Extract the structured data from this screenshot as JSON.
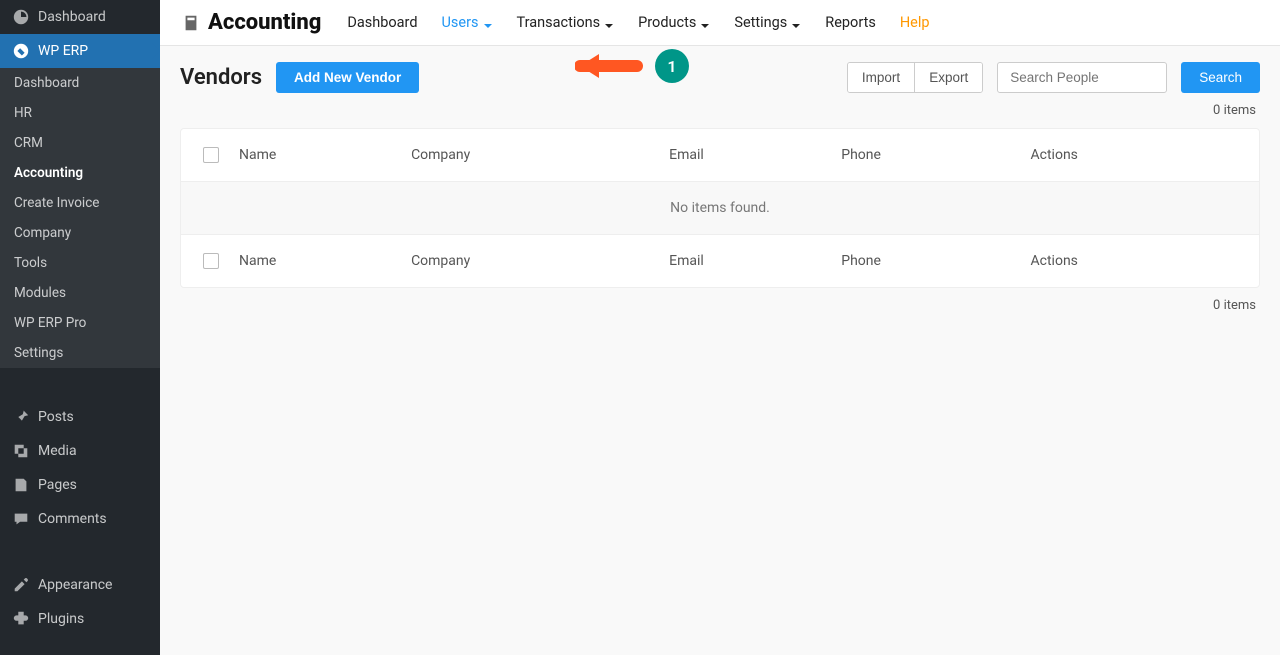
{
  "sidebar": {
    "top": [
      {
        "label": "Dashboard",
        "icon": "dashboard"
      },
      {
        "label": "WP ERP",
        "icon": "erp",
        "active": true
      }
    ],
    "sub": [
      {
        "label": "Dashboard"
      },
      {
        "label": "HR"
      },
      {
        "label": "CRM"
      },
      {
        "label": "Accounting",
        "current": true
      },
      {
        "label": "Create Invoice"
      },
      {
        "label": "Company"
      },
      {
        "label": "Tools"
      },
      {
        "label": "Modules"
      },
      {
        "label": "WP ERP Pro"
      },
      {
        "label": "Settings"
      }
    ],
    "bottom": [
      {
        "label": "Posts",
        "icon": "pin"
      },
      {
        "label": "Media",
        "icon": "media"
      },
      {
        "label": "Pages",
        "icon": "pages"
      },
      {
        "label": "Comments",
        "icon": "comments"
      },
      {
        "label": "Appearance",
        "icon": "appearance"
      },
      {
        "label": "Plugins",
        "icon": "plugins"
      }
    ]
  },
  "topbar": {
    "app_title": "Accounting",
    "nav": [
      {
        "label": "Dashboard"
      },
      {
        "label": "Users",
        "dropdown": true,
        "active": true
      },
      {
        "label": "Transactions",
        "dropdown": true
      },
      {
        "label": "Products",
        "dropdown": true
      },
      {
        "label": "Settings",
        "dropdown": true
      },
      {
        "label": "Reports"
      },
      {
        "label": "Help",
        "help": true
      }
    ]
  },
  "page": {
    "title": "Vendors",
    "add_button": "Add New Vendor",
    "import_label": "Import",
    "export_label": "Export",
    "search_placeholder": "Search People",
    "search_button": "Search",
    "count_top": "0 items",
    "count_bottom": "0 items",
    "columns": {
      "name": "Name",
      "company": "Company",
      "email": "Email",
      "phone": "Phone",
      "actions": "Actions"
    },
    "empty_message": "No items found.",
    "annotation_badge": "1"
  }
}
